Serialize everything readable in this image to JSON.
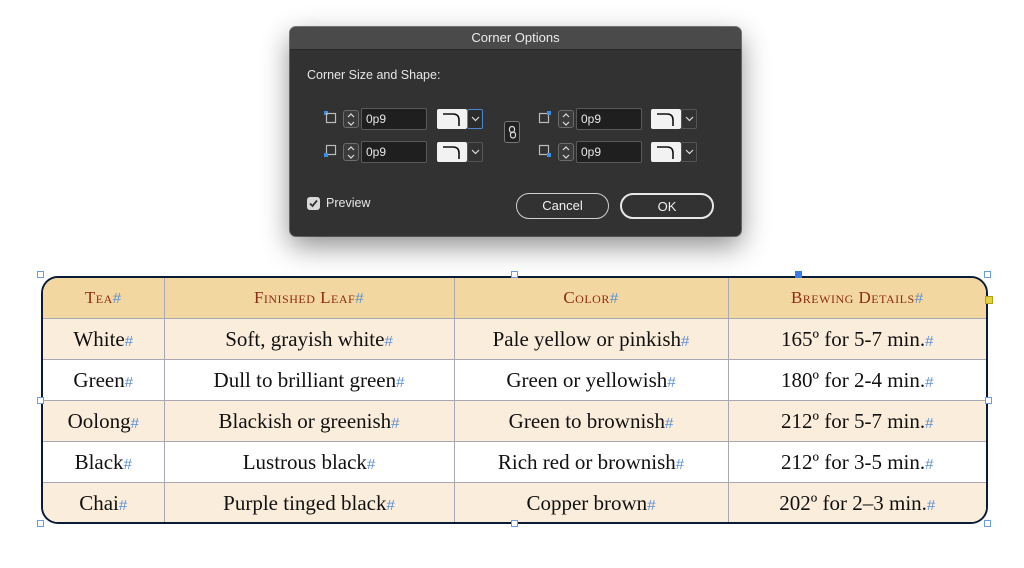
{
  "dialog": {
    "title": "Corner Options",
    "section_label": "Corner Size and Shape:",
    "corners": [
      {
        "name": "top-left",
        "size": "0p9"
      },
      {
        "name": "top-right",
        "size": "0p9"
      },
      {
        "name": "bottom-left",
        "size": "0p9"
      },
      {
        "name": "bottom-right",
        "size": "0p9"
      }
    ],
    "preview_label": "Preview",
    "preview_checked": true,
    "cancel_label": "Cancel",
    "ok_label": "OK"
  },
  "table": {
    "headers": [
      "Tea",
      "Finished Leaf",
      "Color",
      "Brewing Details"
    ],
    "rows": [
      [
        "White",
        "Soft, grayish white",
        "Pale yellow or pinkish",
        "165º for 5-7 min."
      ],
      [
        "Green",
        "Dull to brilliant green",
        "Green or yellowish",
        "180º for 2-4 min."
      ],
      [
        "Oolong",
        "Blackish or greenish",
        "Green to brownish",
        "212º for 5-7 min."
      ],
      [
        "Black",
        "Lustrous black",
        "Rich red or brownish",
        "212º for 3-5 min."
      ],
      [
        "Chai",
        "Purple tinged black",
        "Copper brown",
        "202º for 2–3 min."
      ]
    ],
    "end_marker": "#",
    "colors": {
      "header_bg": "#f2d7a0",
      "header_text": "#8e2b16",
      "row_alt_bg": "#fbeddb",
      "border": "#0b1b35"
    }
  }
}
